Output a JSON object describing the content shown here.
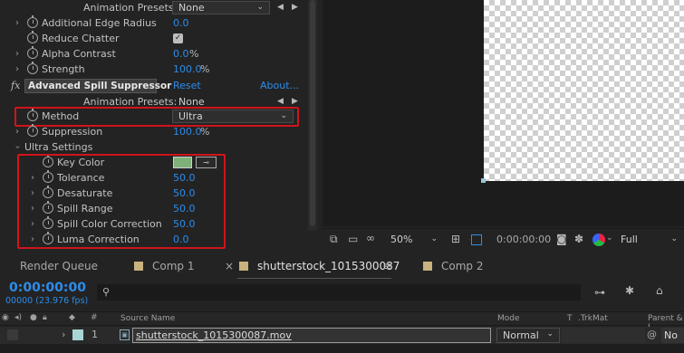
{
  "effects": {
    "top_rows": [
      {
        "label": "Animation Presets:",
        "value": "None"
      },
      {
        "label": "Additional Edge Radius",
        "value": "0.0"
      },
      {
        "label": "Reduce Chatter",
        "checked": true
      },
      {
        "label": "Alpha Contrast",
        "value": "0.0",
        "unit": "%"
      },
      {
        "label": "Strength",
        "value": "100.0",
        "unit": "%"
      }
    ],
    "header": {
      "fx": "fx",
      "name": "Advanced Spill Suppressor",
      "reset": "Reset",
      "about": "About..."
    },
    "presets": {
      "label": "Animation Presets:",
      "value": "None"
    },
    "method": {
      "label": "Method",
      "value": "Ultra"
    },
    "suppression": {
      "label": "Suppression",
      "value": "100.0",
      "unit": "%"
    },
    "ultra": {
      "label": "Ultra Settings"
    },
    "ultra_rows": [
      {
        "label": "Key Color",
        "color": "#7fb07a"
      },
      {
        "label": "Tolerance",
        "value": "50.0"
      },
      {
        "label": "Desaturate",
        "value": "50.0"
      },
      {
        "label": "Spill Range",
        "value": "50.0"
      },
      {
        "label": "Spill Color Correction",
        "value": "50.0"
      },
      {
        "label": "Luma Correction",
        "value": "0.0"
      }
    ]
  },
  "viewer": {
    "zoom": "50%",
    "timecode": "0:00:00:00",
    "resolution": "Full"
  },
  "tabs": {
    "render_queue": "Render Queue",
    "comp1": "Comp 1",
    "active": "shutterstock_1015300087",
    "comp2": "Comp 2",
    "close": "×",
    "menu": "≡"
  },
  "timeline": {
    "timecode": "0:00:00:00",
    "frames": "00000 (23.976 fps)",
    "search_placeholder": ""
  },
  "columns": {
    "source_name": "Source Name",
    "mode": "Mode",
    "t": "T",
    "trkmat": ".TrkMat",
    "parent": "Parent & L",
    "hash": "#"
  },
  "layer": {
    "number": "1",
    "name": "shutterstock_1015300087.mov",
    "mode": "Normal",
    "parent": "No"
  },
  "colors": {
    "accent_blue": "#2d8ceb",
    "highlight_red": "#d0141b",
    "label_tan": "#c9b27e"
  }
}
